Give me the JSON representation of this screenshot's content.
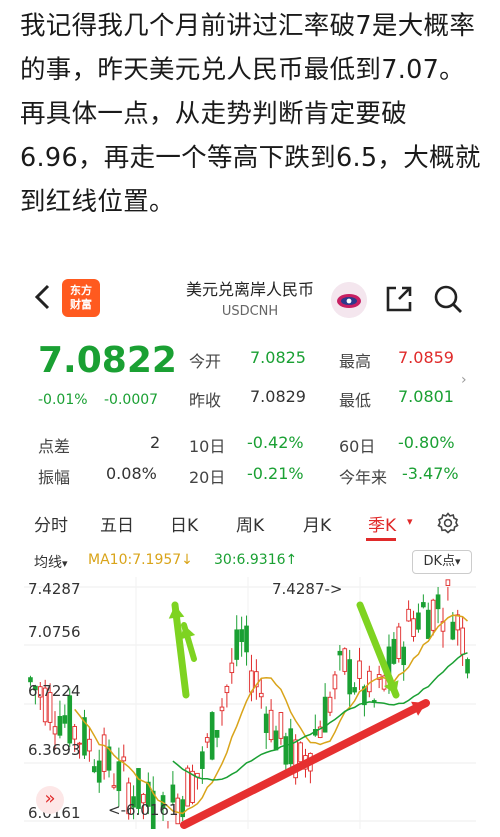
{
  "post": {
    "text": "我记得我几个月前讲过汇率破7是大概率的事，昨天美元兑人民币最低到7.07。再具体一点，从走势判断肯定要破6.96，再走一个等高下跌到6.5，大概就到红线位置。"
  },
  "header": {
    "logo_line1": "东方",
    "logo_line2": "财富",
    "title": "美元兑离岸人民币",
    "subtitle": "USDCNH"
  },
  "quote": {
    "price": "7.0822",
    "change_pct": "-0.01%",
    "change": "-0.0007",
    "rows": [
      [
        {
          "label": "今开",
          "value": "7.0825",
          "color": "#1aa033"
        },
        {
          "label": "最高",
          "value": "7.0859",
          "color": "#e02a2a"
        }
      ],
      [
        {
          "label": "昨收",
          "value": "7.0829",
          "color": "#333333"
        },
        {
          "label": "最低",
          "value": "7.0801",
          "color": "#1aa033"
        }
      ]
    ],
    "stats": [
      {
        "label": "点差",
        "value": "2"
      },
      {
        "label": "10日",
        "value": "-0.42%"
      },
      {
        "label": "60日",
        "value": "-0.80%"
      },
      {
        "label": "振幅",
        "value": "0.08%"
      },
      {
        "label": "20日",
        "value": "-0.21%"
      },
      {
        "label": "今年来",
        "value": "-3.47%"
      }
    ],
    "expand": "›"
  },
  "tabs": {
    "items": [
      "分时",
      "五日",
      "日K",
      "周K",
      "月K",
      "季K"
    ],
    "active": "季K",
    "caret": "▾"
  },
  "legend": {
    "avg": "均线",
    "caret": "▾",
    "ma10": "MA10:7.1957↓",
    "ma30": "30:6.9316↑",
    "dk": "DK点",
    "dk_caret": "▾"
  },
  "chart_data": {
    "type": "candlestick",
    "y_ticks": [
      "7.4287",
      "7.0756",
      "6.7224",
      "6.3693",
      "6.0161"
    ],
    "ylim": [
      6.0161,
      7.4287
    ],
    "max_label": "7.4287->",
    "min_label": "<-6.0161",
    "collapse_icon": "»",
    "colors": {
      "up": "#e02a2a",
      "down": "#1aa033",
      "ma10": "#d9a41a",
      "ma30": "#1aa033",
      "arrow_green": "#7ed321",
      "arrow_red": "#e63030"
    }
  }
}
